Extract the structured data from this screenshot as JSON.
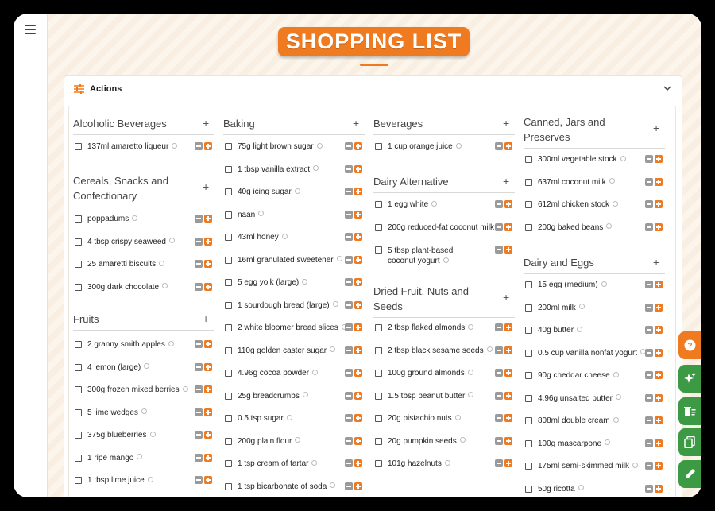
{
  "header": {
    "title": "SHOPPING LIST"
  },
  "actions": {
    "label": "Actions"
  },
  "categories": [
    {
      "name": "Alcoholic Beverages",
      "items": [
        "137ml amaretto liqueur"
      ]
    },
    {
      "name": "Cereals, Snacks and Confectionary",
      "items": [
        "poppadums",
        "4 tbsp crispy seaweed",
        "25 amaretti biscuits",
        "300g dark chocolate"
      ]
    },
    {
      "name": "Fruits",
      "items": [
        "2 granny smith apples",
        "4 lemon (large)",
        "300g frozen mixed berries",
        "5 lime wedges",
        "375g blueberries",
        "1 ripe mango",
        "1 tbsp lime juice"
      ]
    },
    {
      "name": "Baking",
      "items": [
        "75g light brown sugar",
        "1 tbsp vanilla extract",
        "40g icing sugar",
        "naan",
        "43ml honey",
        "16ml granulated sweetener",
        "5 egg yolk (large)",
        "1 sourdough bread (large)",
        "2 white bloomer bread slices",
        "110g golden caster sugar",
        "4.96g cocoa powder",
        "25g breadcrumbs",
        "0.5 tsp sugar",
        "200g plain flour",
        "1 tsp cream of tartar",
        "1 tsp bicarbonate of soda"
      ]
    },
    {
      "name": "Beverages",
      "items": [
        "1 cup orange juice"
      ]
    },
    {
      "name": "Dairy Alternative",
      "items": [
        "1 egg white",
        "200g reduced-fat coconut milk",
        "5 tbsp plant-based coconut yogurt"
      ]
    },
    {
      "name": "Dried Fruit, Nuts and Seeds",
      "items": [
        "2 tbsp flaked almonds",
        "2 tbsp black sesame seeds",
        "100g ground almonds",
        "1.5 tbsp peanut butter",
        "20g pistachio nuts",
        "20g pumpkin seeds",
        "101g hazelnuts"
      ]
    },
    {
      "name": "Canned, Jars and Preserves",
      "items": [
        "300ml vegetable stock",
        "637ml coconut milk",
        "612ml chicken stock",
        "200g baked beans"
      ]
    },
    {
      "name": "Dairy and Eggs",
      "items": [
        "15 egg (medium)",
        "200ml milk",
        "40g butter",
        "0.5 cup vanilla nonfat yogurt",
        "90g cheddar cheese",
        "4.96g unsalted butter",
        "808ml double cream",
        "100g mascarpone",
        "175ml semi-skimmed milk",
        "50g ricotta"
      ]
    }
  ],
  "add_symbol": "+",
  "fabs": [
    {
      "name": "help",
      "icon": "help-icon",
      "color": "#f07a1f"
    },
    {
      "name": "ai",
      "icon": "sparkle-icon",
      "color": "#3c9a45"
    },
    {
      "name": "clear",
      "icon": "trash-list-icon",
      "color": "#3c9a45"
    },
    {
      "name": "copy",
      "icon": "copy-icon",
      "color": "#3c9a45"
    },
    {
      "name": "edit",
      "icon": "pencil-icon",
      "color": "#3c9a45"
    }
  ]
}
